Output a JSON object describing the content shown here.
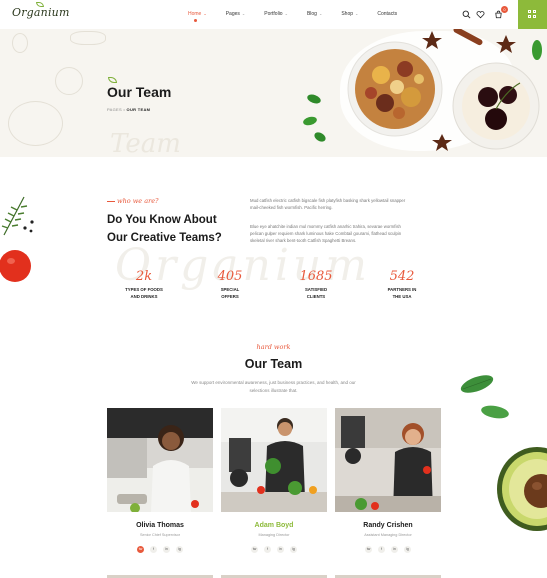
{
  "header": {
    "logo": "Organium",
    "nav": [
      {
        "label": "Home",
        "caret": "⌄",
        "active": true
      },
      {
        "label": "Pages",
        "caret": "⌄"
      },
      {
        "label": "Portfolio",
        "caret": "⌄"
      },
      {
        "label": "Blog",
        "caret": "⌄"
      },
      {
        "label": "Shop",
        "caret": "⌄"
      },
      {
        "label": "Contacts",
        "caret": ""
      }
    ],
    "cart_count": "0",
    "accent": "#e8593c",
    "green": "#8dba3a"
  },
  "hero": {
    "title": "Our Team",
    "breadcrumb_parent": "PAGES",
    "breadcrumb_sep": "•",
    "breadcrumb_current": "OUR TEAM",
    "ghost_text": "Team"
  },
  "intro": {
    "script": "who we are?",
    "title_line1": "Do You Know About",
    "title_line2": "Our Creative Teams?",
    "para1": "Mud catfish electric catfish bigscale fish platyfish basking shark yellowtail snapper mail-cheeked fish wormfish. Pacific herring.",
    "para2": "Blue eye ahatchite indian mul mommy catfish anarhic trahira, sevarae wormfish pelican gulper requiem shark luminous hake Combtail gourami, flathead sculpin skeletal river shark bent-tooth Catfish Spaghetti Breans.",
    "ghost_word": "Organium",
    "stats": [
      {
        "num": "2k",
        "label1": "TYPES OF FOODS",
        "label2": "AND DRINKS"
      },
      {
        "num": "405",
        "label1": "SPECIAL",
        "label2": "OFFERS"
      },
      {
        "num": "1685",
        "label1": "SATISFIED",
        "label2": "CLIENTS"
      },
      {
        "num": "542",
        "label1": "PARTNERS IN",
        "label2": "THE USA"
      }
    ]
  },
  "team": {
    "script": "hard work",
    "title": "Our Team",
    "subtitle": "We support environmental awareness, just business practices, and health, and our selections illustrate that.",
    "members": [
      {
        "name": "Olivia Thomas",
        "role": "Senior Chief Supervisor",
        "highlight": false,
        "socials": [
          "tw",
          "f",
          "in",
          "ig"
        ],
        "active_social": 0
      },
      {
        "name": "Adam Boyd",
        "role": "Managing Director",
        "highlight": true,
        "socials": [
          "tw",
          "f",
          "in",
          "ig"
        ],
        "active_social": -1
      },
      {
        "name": "Randy Crishen",
        "role": "Assistant Managing Director",
        "highlight": false,
        "socials": [
          "tw",
          "f",
          "in",
          "ig"
        ],
        "active_social": -1
      }
    ]
  }
}
